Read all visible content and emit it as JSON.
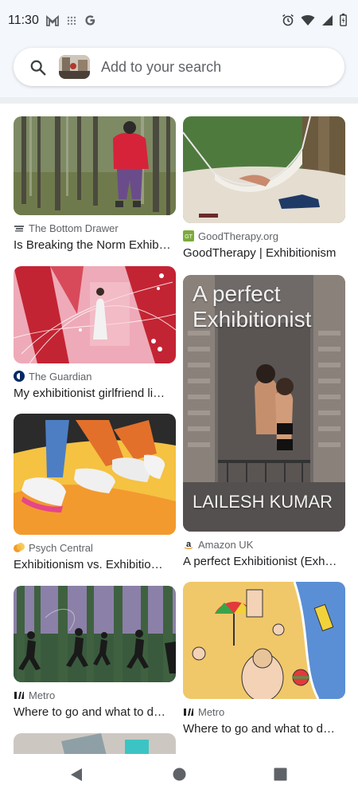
{
  "status_bar": {
    "time": "11:30",
    "left_icons": [
      "gmail-icon",
      "apps-grid-icon",
      "google-g-icon"
    ],
    "right_icons": [
      "alarm-icon",
      "wifi-icon",
      "signal-icon",
      "battery-icon"
    ]
  },
  "search": {
    "placeholder": "Add to your search"
  },
  "results": {
    "left": [
      {
        "source": "The Bottom Drawer",
        "title": "Is Breaking the Norm Exhib…"
      },
      {
        "source": "The Guardian",
        "title": "My exhibitionist girlfriend li…"
      },
      {
        "source": "Psych Central",
        "title": "Exhibitionism vs. Exhibitio…"
      },
      {
        "source": "Metro",
        "title": "Where to go and what to d…"
      }
    ],
    "right": [
      {
        "source": "GoodTherapy.org",
        "title": "GoodTherapy | Exhibitionism"
      },
      {
        "source": "Amazon UK",
        "title": "A perfect Exhibitionist (Exh…",
        "cover_title_line1": "A perfect",
        "cover_title_line2": "Exhibitionist",
        "cover_author": "LAILESH KUMAR"
      },
      {
        "source": "Metro",
        "title": "Where to go and what to d…"
      }
    ]
  },
  "colors": {
    "status_bg": "#f4f7fb",
    "text_primary": "#202124",
    "text_secondary": "#5f6368"
  }
}
